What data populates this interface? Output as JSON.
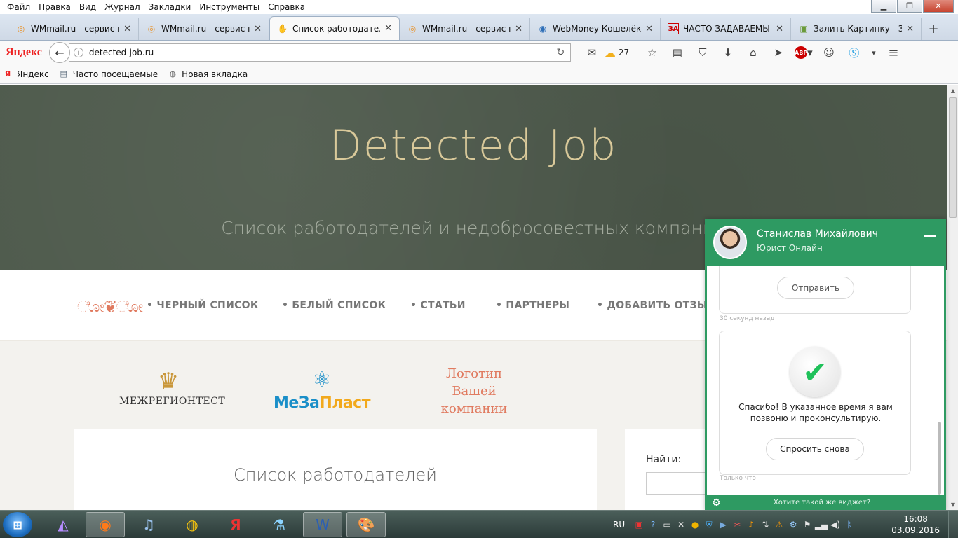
{
  "menu": [
    "Файл",
    "Правка",
    "Вид",
    "Журнал",
    "Закладки",
    "Инструменты",
    "Справка"
  ],
  "window_controls": {
    "minimize": "▁",
    "maximize": "❐",
    "close": "✕"
  },
  "tabs": [
    {
      "label": "WMmail.ru - сервис п...",
      "icon": "wmmail-icon",
      "glyph": "◎"
    },
    {
      "label": "WMmail.ru - сервис п...",
      "icon": "wmmail-icon",
      "glyph": "◎"
    },
    {
      "label": "Список работодателей",
      "icon": "hand-icon",
      "glyph": "✋"
    },
    {
      "label": "WMmail.ru - сервис п...",
      "icon": "wmmail-icon",
      "glyph": "◎"
    },
    {
      "label": "WebMoney Кошелёк »",
      "icon": "globe-icon",
      "glyph": "◉"
    },
    {
      "label": "ЧАСТО ЗАДАВАЕМЫ...",
      "icon": "za-icon",
      "glyph": "ЗА"
    },
    {
      "label": "Залить Картинку - За...",
      "icon": "image-icon",
      "glyph": "▣"
    }
  ],
  "tab_close": "✕",
  "new_tab": "+",
  "nav": {
    "yandex_logo": "Яндекс",
    "back": "←",
    "info": "i",
    "url": "detected-job.ru",
    "reload": "↻",
    "weather_temp": "27"
  },
  "bookmarks": [
    {
      "label": "Яндекс",
      "glyph": "Я"
    },
    {
      "label": "Часто посещаемые",
      "glyph": "▤"
    },
    {
      "label": "Новая вкладка",
      "glyph": "◍"
    }
  ],
  "site": {
    "title": "Detected Job",
    "subtitle": "Список работодателей и недобросовестных компаний",
    "ornament": "ೋ❦ೋ",
    "menu": [
      "• ЧЕРНЫЙ СПИСОК",
      "• БЕЛЫЙ СПИСОК",
      "• СТАТЬИ",
      "• ПАРТНЕРЫ",
      "• ДОБАВИТЬ ОТЗЫВ"
    ],
    "logos": {
      "logo1_text": "МЕЖРЕГИОНТЕСТ",
      "logo2_part1": "МеЗа",
      "logo2_part2": "Пласт",
      "logo3_line1": "Логотип",
      "logo3_line2": "Вашей",
      "logo3_line3": "компании"
    },
    "card_title": "Список работодателей",
    "search_label": "Найти:"
  },
  "chat": {
    "name": "Станислав Михайлович",
    "role": "Юрист Онлайн",
    "minimize": "—",
    "send_button": "Отправить",
    "timestamp1": "30 секунд назад",
    "check": "✔",
    "thanks": "Спасибо! В указанное время я вам позвоню и проконсультирую.",
    "ask_again": "Спросить снова",
    "timestamp2": "Только что",
    "promo": "Хотите такой же виджет?",
    "gear": "⚙"
  },
  "taskbar": {
    "lang": "RU",
    "time": "16:08",
    "date": "03.09.2016"
  },
  "colors": {
    "chat_green": "#2e9a62",
    "hero_bg": "#4e5a4c",
    "title_gold": "#d9c99a",
    "accent_coral": "#e07a5f"
  }
}
